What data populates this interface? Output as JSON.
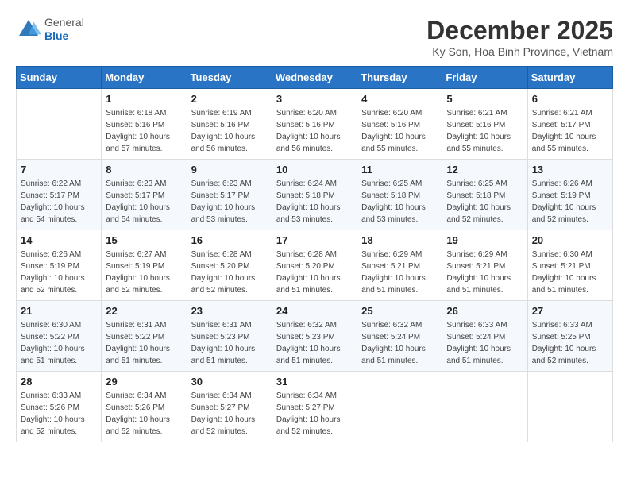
{
  "logo": {
    "general": "General",
    "blue": "Blue"
  },
  "title": "December 2025",
  "location": "Ky Son, Hoa Binh Province, Vietnam",
  "days_of_week": [
    "Sunday",
    "Monday",
    "Tuesday",
    "Wednesday",
    "Thursday",
    "Friday",
    "Saturday"
  ],
  "weeks": [
    [
      {
        "day": "",
        "sunrise": "",
        "sunset": "",
        "daylight": ""
      },
      {
        "day": "1",
        "sunrise": "Sunrise: 6:18 AM",
        "sunset": "Sunset: 5:16 PM",
        "daylight": "Daylight: 10 hours and 57 minutes."
      },
      {
        "day": "2",
        "sunrise": "Sunrise: 6:19 AM",
        "sunset": "Sunset: 5:16 PM",
        "daylight": "Daylight: 10 hours and 56 minutes."
      },
      {
        "day": "3",
        "sunrise": "Sunrise: 6:20 AM",
        "sunset": "Sunset: 5:16 PM",
        "daylight": "Daylight: 10 hours and 56 minutes."
      },
      {
        "day": "4",
        "sunrise": "Sunrise: 6:20 AM",
        "sunset": "Sunset: 5:16 PM",
        "daylight": "Daylight: 10 hours and 55 minutes."
      },
      {
        "day": "5",
        "sunrise": "Sunrise: 6:21 AM",
        "sunset": "Sunset: 5:16 PM",
        "daylight": "Daylight: 10 hours and 55 minutes."
      },
      {
        "day": "6",
        "sunrise": "Sunrise: 6:21 AM",
        "sunset": "Sunset: 5:17 PM",
        "daylight": "Daylight: 10 hours and 55 minutes."
      }
    ],
    [
      {
        "day": "7",
        "sunrise": "Sunrise: 6:22 AM",
        "sunset": "Sunset: 5:17 PM",
        "daylight": "Daylight: 10 hours and 54 minutes."
      },
      {
        "day": "8",
        "sunrise": "Sunrise: 6:23 AM",
        "sunset": "Sunset: 5:17 PM",
        "daylight": "Daylight: 10 hours and 54 minutes."
      },
      {
        "day": "9",
        "sunrise": "Sunrise: 6:23 AM",
        "sunset": "Sunset: 5:17 PM",
        "daylight": "Daylight: 10 hours and 53 minutes."
      },
      {
        "day": "10",
        "sunrise": "Sunrise: 6:24 AM",
        "sunset": "Sunset: 5:18 PM",
        "daylight": "Daylight: 10 hours and 53 minutes."
      },
      {
        "day": "11",
        "sunrise": "Sunrise: 6:25 AM",
        "sunset": "Sunset: 5:18 PM",
        "daylight": "Daylight: 10 hours and 53 minutes."
      },
      {
        "day": "12",
        "sunrise": "Sunrise: 6:25 AM",
        "sunset": "Sunset: 5:18 PM",
        "daylight": "Daylight: 10 hours and 52 minutes."
      },
      {
        "day": "13",
        "sunrise": "Sunrise: 6:26 AM",
        "sunset": "Sunset: 5:19 PM",
        "daylight": "Daylight: 10 hours and 52 minutes."
      }
    ],
    [
      {
        "day": "14",
        "sunrise": "Sunrise: 6:26 AM",
        "sunset": "Sunset: 5:19 PM",
        "daylight": "Daylight: 10 hours and 52 minutes."
      },
      {
        "day": "15",
        "sunrise": "Sunrise: 6:27 AM",
        "sunset": "Sunset: 5:19 PM",
        "daylight": "Daylight: 10 hours and 52 minutes."
      },
      {
        "day": "16",
        "sunrise": "Sunrise: 6:28 AM",
        "sunset": "Sunset: 5:20 PM",
        "daylight": "Daylight: 10 hours and 52 minutes."
      },
      {
        "day": "17",
        "sunrise": "Sunrise: 6:28 AM",
        "sunset": "Sunset: 5:20 PM",
        "daylight": "Daylight: 10 hours and 51 minutes."
      },
      {
        "day": "18",
        "sunrise": "Sunrise: 6:29 AM",
        "sunset": "Sunset: 5:21 PM",
        "daylight": "Daylight: 10 hours and 51 minutes."
      },
      {
        "day": "19",
        "sunrise": "Sunrise: 6:29 AM",
        "sunset": "Sunset: 5:21 PM",
        "daylight": "Daylight: 10 hours and 51 minutes."
      },
      {
        "day": "20",
        "sunrise": "Sunrise: 6:30 AM",
        "sunset": "Sunset: 5:21 PM",
        "daylight": "Daylight: 10 hours and 51 minutes."
      }
    ],
    [
      {
        "day": "21",
        "sunrise": "Sunrise: 6:30 AM",
        "sunset": "Sunset: 5:22 PM",
        "daylight": "Daylight: 10 hours and 51 minutes."
      },
      {
        "day": "22",
        "sunrise": "Sunrise: 6:31 AM",
        "sunset": "Sunset: 5:22 PM",
        "daylight": "Daylight: 10 hours and 51 minutes."
      },
      {
        "day": "23",
        "sunrise": "Sunrise: 6:31 AM",
        "sunset": "Sunset: 5:23 PM",
        "daylight": "Daylight: 10 hours and 51 minutes."
      },
      {
        "day": "24",
        "sunrise": "Sunrise: 6:32 AM",
        "sunset": "Sunset: 5:23 PM",
        "daylight": "Daylight: 10 hours and 51 minutes."
      },
      {
        "day": "25",
        "sunrise": "Sunrise: 6:32 AM",
        "sunset": "Sunset: 5:24 PM",
        "daylight": "Daylight: 10 hours and 51 minutes."
      },
      {
        "day": "26",
        "sunrise": "Sunrise: 6:33 AM",
        "sunset": "Sunset: 5:24 PM",
        "daylight": "Daylight: 10 hours and 51 minutes."
      },
      {
        "day": "27",
        "sunrise": "Sunrise: 6:33 AM",
        "sunset": "Sunset: 5:25 PM",
        "daylight": "Daylight: 10 hours and 52 minutes."
      }
    ],
    [
      {
        "day": "28",
        "sunrise": "Sunrise: 6:33 AM",
        "sunset": "Sunset: 5:26 PM",
        "daylight": "Daylight: 10 hours and 52 minutes."
      },
      {
        "day": "29",
        "sunrise": "Sunrise: 6:34 AM",
        "sunset": "Sunset: 5:26 PM",
        "daylight": "Daylight: 10 hours and 52 minutes."
      },
      {
        "day": "30",
        "sunrise": "Sunrise: 6:34 AM",
        "sunset": "Sunset: 5:27 PM",
        "daylight": "Daylight: 10 hours and 52 minutes."
      },
      {
        "day": "31",
        "sunrise": "Sunrise: 6:34 AM",
        "sunset": "Sunset: 5:27 PM",
        "daylight": "Daylight: 10 hours and 52 minutes."
      },
      {
        "day": "",
        "sunrise": "",
        "sunset": "",
        "daylight": ""
      },
      {
        "day": "",
        "sunrise": "",
        "sunset": "",
        "daylight": ""
      },
      {
        "day": "",
        "sunrise": "",
        "sunset": "",
        "daylight": ""
      }
    ]
  ]
}
